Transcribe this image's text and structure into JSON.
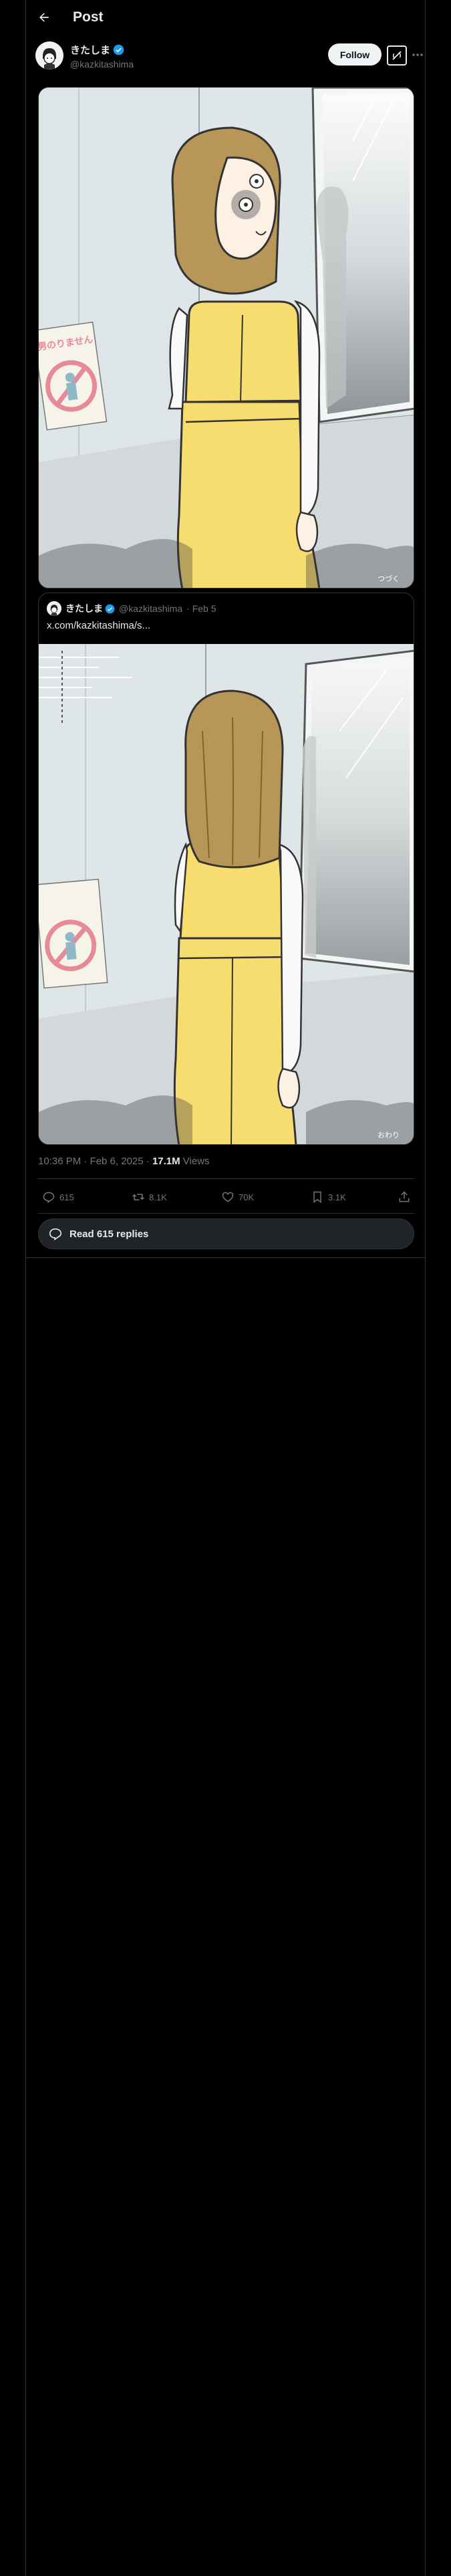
{
  "topbar": {
    "title": "Post",
    "back_icon": "arrow-left-icon"
  },
  "author": {
    "display_name": "きたしま",
    "handle": "@kazkitashima",
    "verified": true,
    "verified_color": "#1d9bf0"
  },
  "buttons": {
    "follow": "Follow",
    "grok_icon": "grok-icon",
    "more_icon": "more-dots-icon"
  },
  "media": {
    "caption_mark": "つづく",
    "sign_text": "男のりません"
  },
  "quoted_post": {
    "display_name": "きたしま",
    "handle": "@kazkitashima",
    "date": "· Feb 5",
    "text": "x.com/kazkitashima/s...",
    "caption_mark": "おわり"
  },
  "meta": {
    "time": "10:36 PM · Feb 6, 2025 · ",
    "views_count": "17.1M",
    "views_label": " Views"
  },
  "actions": {
    "replies": "615",
    "reposts": "8.1K",
    "likes": "70K",
    "bookmarks": "3.1K"
  },
  "read_replies": "Read 615 replies",
  "colors": {
    "background": "#000000",
    "border": "#2f3336",
    "muted": "#71767b",
    "text": "#e7e9ea",
    "dress": "#f7dc6f"
  }
}
